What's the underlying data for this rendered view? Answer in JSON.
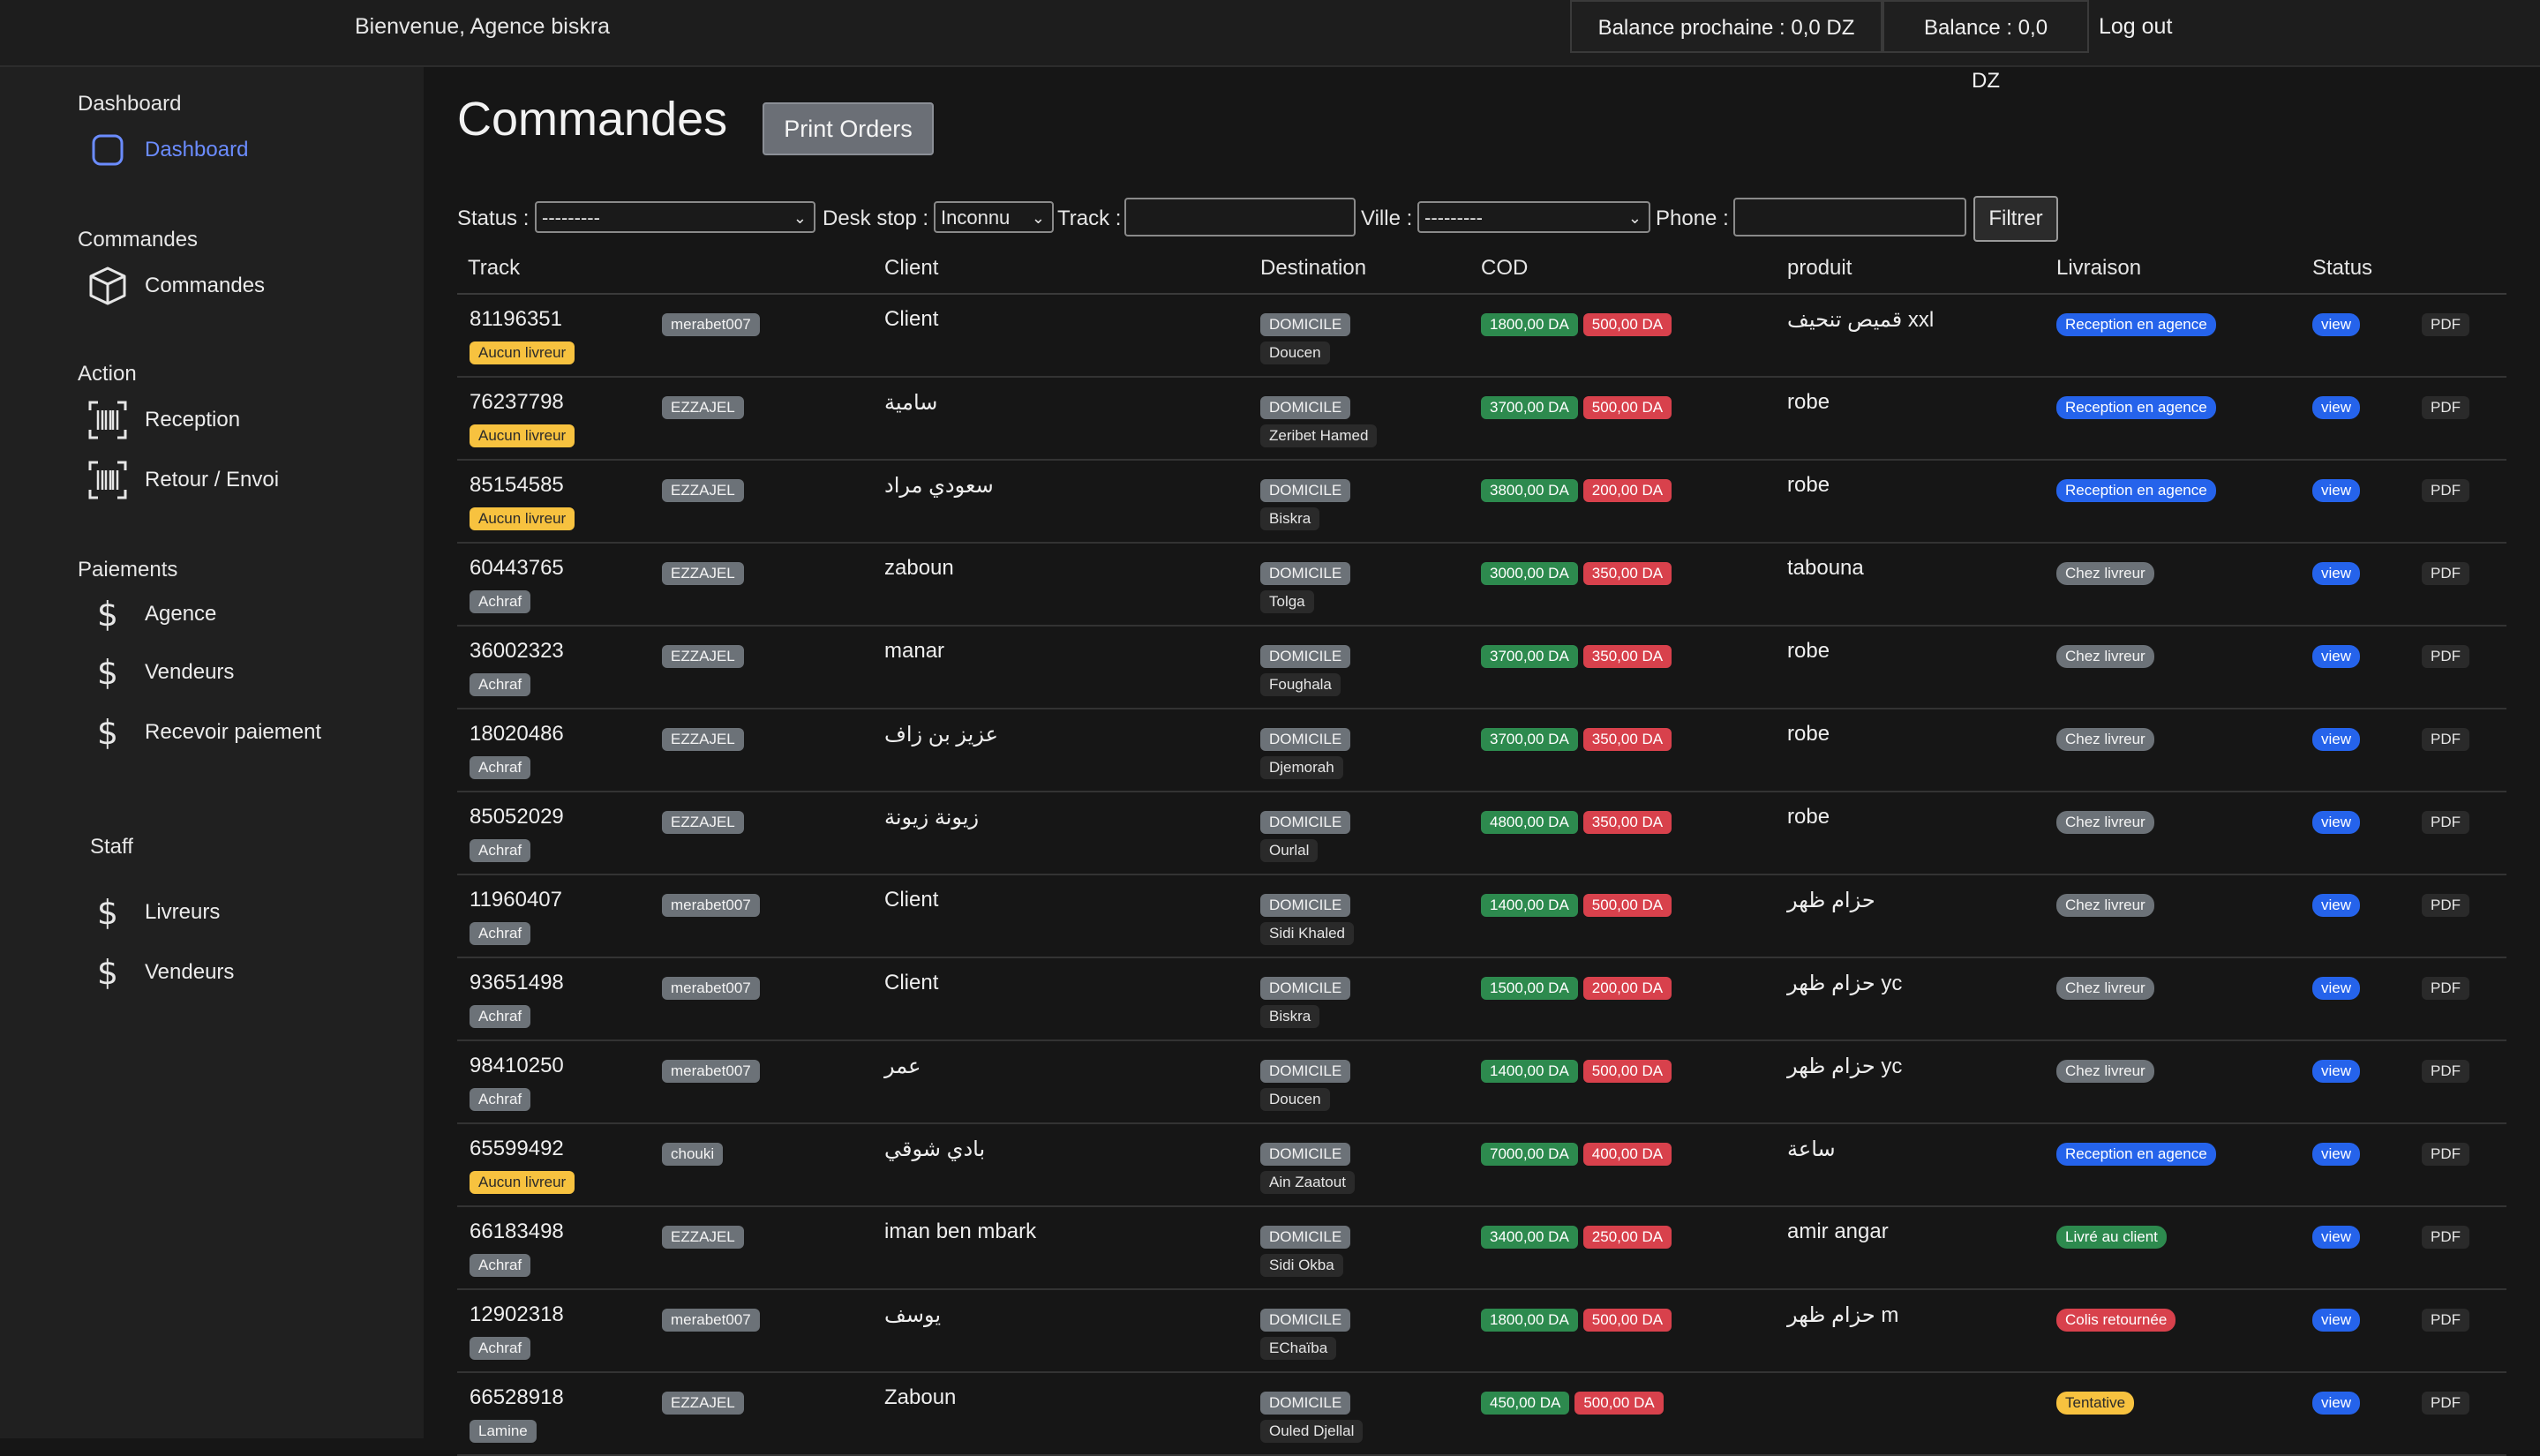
{
  "topbar": {
    "welcome": "Bienvenue, Agence biskra",
    "balance_next": "Balance prochaine : 0,0 DZ",
    "balance": "Balance : 0,0 DZ",
    "logout": "Log out"
  },
  "sidebar": {
    "dashboard_section": "Dashboard",
    "dashboard_item": "Dashboard",
    "commandes_section": "Commandes",
    "commandes_item": "Commandes",
    "action_section": "Action",
    "reception_item": "Reception",
    "retour_item": "Retour / Envoi",
    "paiements_section": "Paiements",
    "agence_item": "Agence",
    "vendeurs_item": "Vendeurs",
    "recevoir_item": "Recevoir paiement",
    "staff_section": "Staff",
    "livreurs_item": "Livreurs",
    "vendeurs_staff_item": "Vendeurs"
  },
  "main": {
    "title": "Commandes",
    "print_button": "Print Orders"
  },
  "filters": {
    "status_label": "Status :",
    "status_value": "---------",
    "desk_label": "Desk stop :",
    "desk_value": "Inconnu",
    "track_label": "Track :",
    "ville_label": "Ville :",
    "ville_value": "---------",
    "phone_label": "Phone :",
    "filter_button": "Filtrer"
  },
  "table": {
    "headers": [
      "Track",
      "Client",
      "Destination",
      "COD",
      "produit",
      "Livraison",
      "Status"
    ],
    "rows": [
      {
        "track": "81196351",
        "livreur": "Aucun livreur",
        "seller": "merabet007",
        "client": "Client",
        "type": "DOMICILE",
        "city": "Doucen",
        "cod": "1800,00 DA",
        "fee": "500,00 DA",
        "product": "قميص تنحيف xxl",
        "livraison": "Reception en agence",
        "view": "view",
        "pdf": "PDF"
      },
      {
        "track": "76237798",
        "livreur": "Aucun livreur",
        "seller": "EZZAJEL",
        "client": "سامية",
        "type": "DOMICILE",
        "city": "Zeribet Hamed",
        "cod": "3700,00 DA",
        "fee": "500,00 DA",
        "product": "robe",
        "livraison": "Reception en agence",
        "view": "view",
        "pdf": "PDF"
      },
      {
        "track": "85154585",
        "livreur": "Aucun livreur",
        "seller": "EZZAJEL",
        "client": "سعودي مراد",
        "type": "DOMICILE",
        "city": "Biskra",
        "cod": "3800,00 DA",
        "fee": "200,00 DA",
        "product": "robe",
        "livraison": "Reception en agence",
        "view": "view",
        "pdf": "PDF"
      },
      {
        "track": "60443765",
        "livreur": "Achraf",
        "seller": "EZZAJEL",
        "client": "zaboun",
        "type": "DOMICILE",
        "city": "Tolga",
        "cod": "3000,00 DA",
        "fee": "350,00 DA",
        "product": "tabouna",
        "livraison": "Chez livreur",
        "view": "view",
        "pdf": "PDF"
      },
      {
        "track": "36002323",
        "livreur": "Achraf",
        "seller": "EZZAJEL",
        "client": "manar",
        "type": "DOMICILE",
        "city": "Foughala",
        "cod": "3700,00 DA",
        "fee": "350,00 DA",
        "product": "robe",
        "livraison": "Chez livreur",
        "view": "view",
        "pdf": "PDF"
      },
      {
        "track": "18020486",
        "livreur": "Achraf",
        "seller": "EZZAJEL",
        "client": "عزيز بن زاف",
        "type": "DOMICILE",
        "city": "Djemorah",
        "cod": "3700,00 DA",
        "fee": "350,00 DA",
        "product": "robe",
        "livraison": "Chez livreur",
        "view": "view",
        "pdf": "PDF"
      },
      {
        "track": "85052029",
        "livreur": "Achraf",
        "seller": "EZZAJEL",
        "client": "زيونة زيونة",
        "type": "DOMICILE",
        "city": "Ourlal",
        "cod": "4800,00 DA",
        "fee": "350,00 DA",
        "product": "robe",
        "livraison": "Chez livreur",
        "view": "view",
        "pdf": "PDF"
      },
      {
        "track": "11960407",
        "livreur": "Achraf",
        "seller": "merabet007",
        "client": "Client",
        "type": "DOMICILE",
        "city": "Sidi Khaled",
        "cod": "1400,00 DA",
        "fee": "500,00 DA",
        "product": "حزام ظهر",
        "livraison": "Chez livreur",
        "view": "view",
        "pdf": "PDF"
      },
      {
        "track": "93651498",
        "livreur": "Achraf",
        "seller": "merabet007",
        "client": "Client",
        "type": "DOMICILE",
        "city": "Biskra",
        "cod": "1500,00 DA",
        "fee": "200,00 DA",
        "product": "حزام ظهر yc",
        "livraison": "Chez livreur",
        "view": "view",
        "pdf": "PDF"
      },
      {
        "track": "98410250",
        "livreur": "Achraf",
        "seller": "merabet007",
        "client": "عمر",
        "type": "DOMICILE",
        "city": "Doucen",
        "cod": "1400,00 DA",
        "fee": "500,00 DA",
        "product": "حزام ظهر yc",
        "livraison": "Chez livreur",
        "view": "view",
        "pdf": "PDF"
      },
      {
        "track": "65599492",
        "livreur": "Aucun livreur",
        "seller": "chouki",
        "client": "بادي شوقي",
        "type": "DOMICILE",
        "city": "Ain Zaatout",
        "cod": "7000,00 DA",
        "fee": "400,00 DA",
        "product": "ساعة",
        "livraison": "Reception en agence",
        "view": "view",
        "pdf": "PDF"
      },
      {
        "track": "66183498",
        "livreur": "Achraf",
        "seller": "EZZAJEL",
        "client": "iman ben mbark",
        "type": "DOMICILE",
        "city": "Sidi Okba",
        "cod": "3400,00 DA",
        "fee": "250,00 DA",
        "product": "amir angar",
        "livraison": "Livré au client",
        "view": "view",
        "pdf": "PDF"
      },
      {
        "track": "12902318",
        "livreur": "Achraf",
        "seller": "merabet007",
        "client": "يوسف",
        "type": "DOMICILE",
        "city": "EChaïba",
        "cod": "1800,00 DA",
        "fee": "500,00 DA",
        "product": "حزام ظهر m",
        "livraison": "Colis retournée",
        "view": "view",
        "pdf": "PDF"
      },
      {
        "track": "66528918",
        "livreur": "Lamine",
        "seller": "EZZAJEL",
        "client": "Zaboun",
        "type": "DOMICILE",
        "city": "Ouled Djellal",
        "cod": "450,00 DA",
        "fee": "500,00 DA",
        "product": "",
        "livraison": "Tentative",
        "view": "view",
        "pdf": "PDF"
      }
    ]
  },
  "colors": {
    "accent_blue": "#2563eb",
    "active_link": "#6b8cff",
    "badge_yellow": "#f7c23f",
    "badge_green": "#2d8a4e",
    "badge_red": "#d8414c",
    "badge_gray": "#6c7278"
  },
  "icons": {
    "dashboard": "rounded-square-icon",
    "commandes": "box-icon",
    "reception": "barcode-icon",
    "retour": "barcode-icon",
    "money": "dollar-icon"
  }
}
